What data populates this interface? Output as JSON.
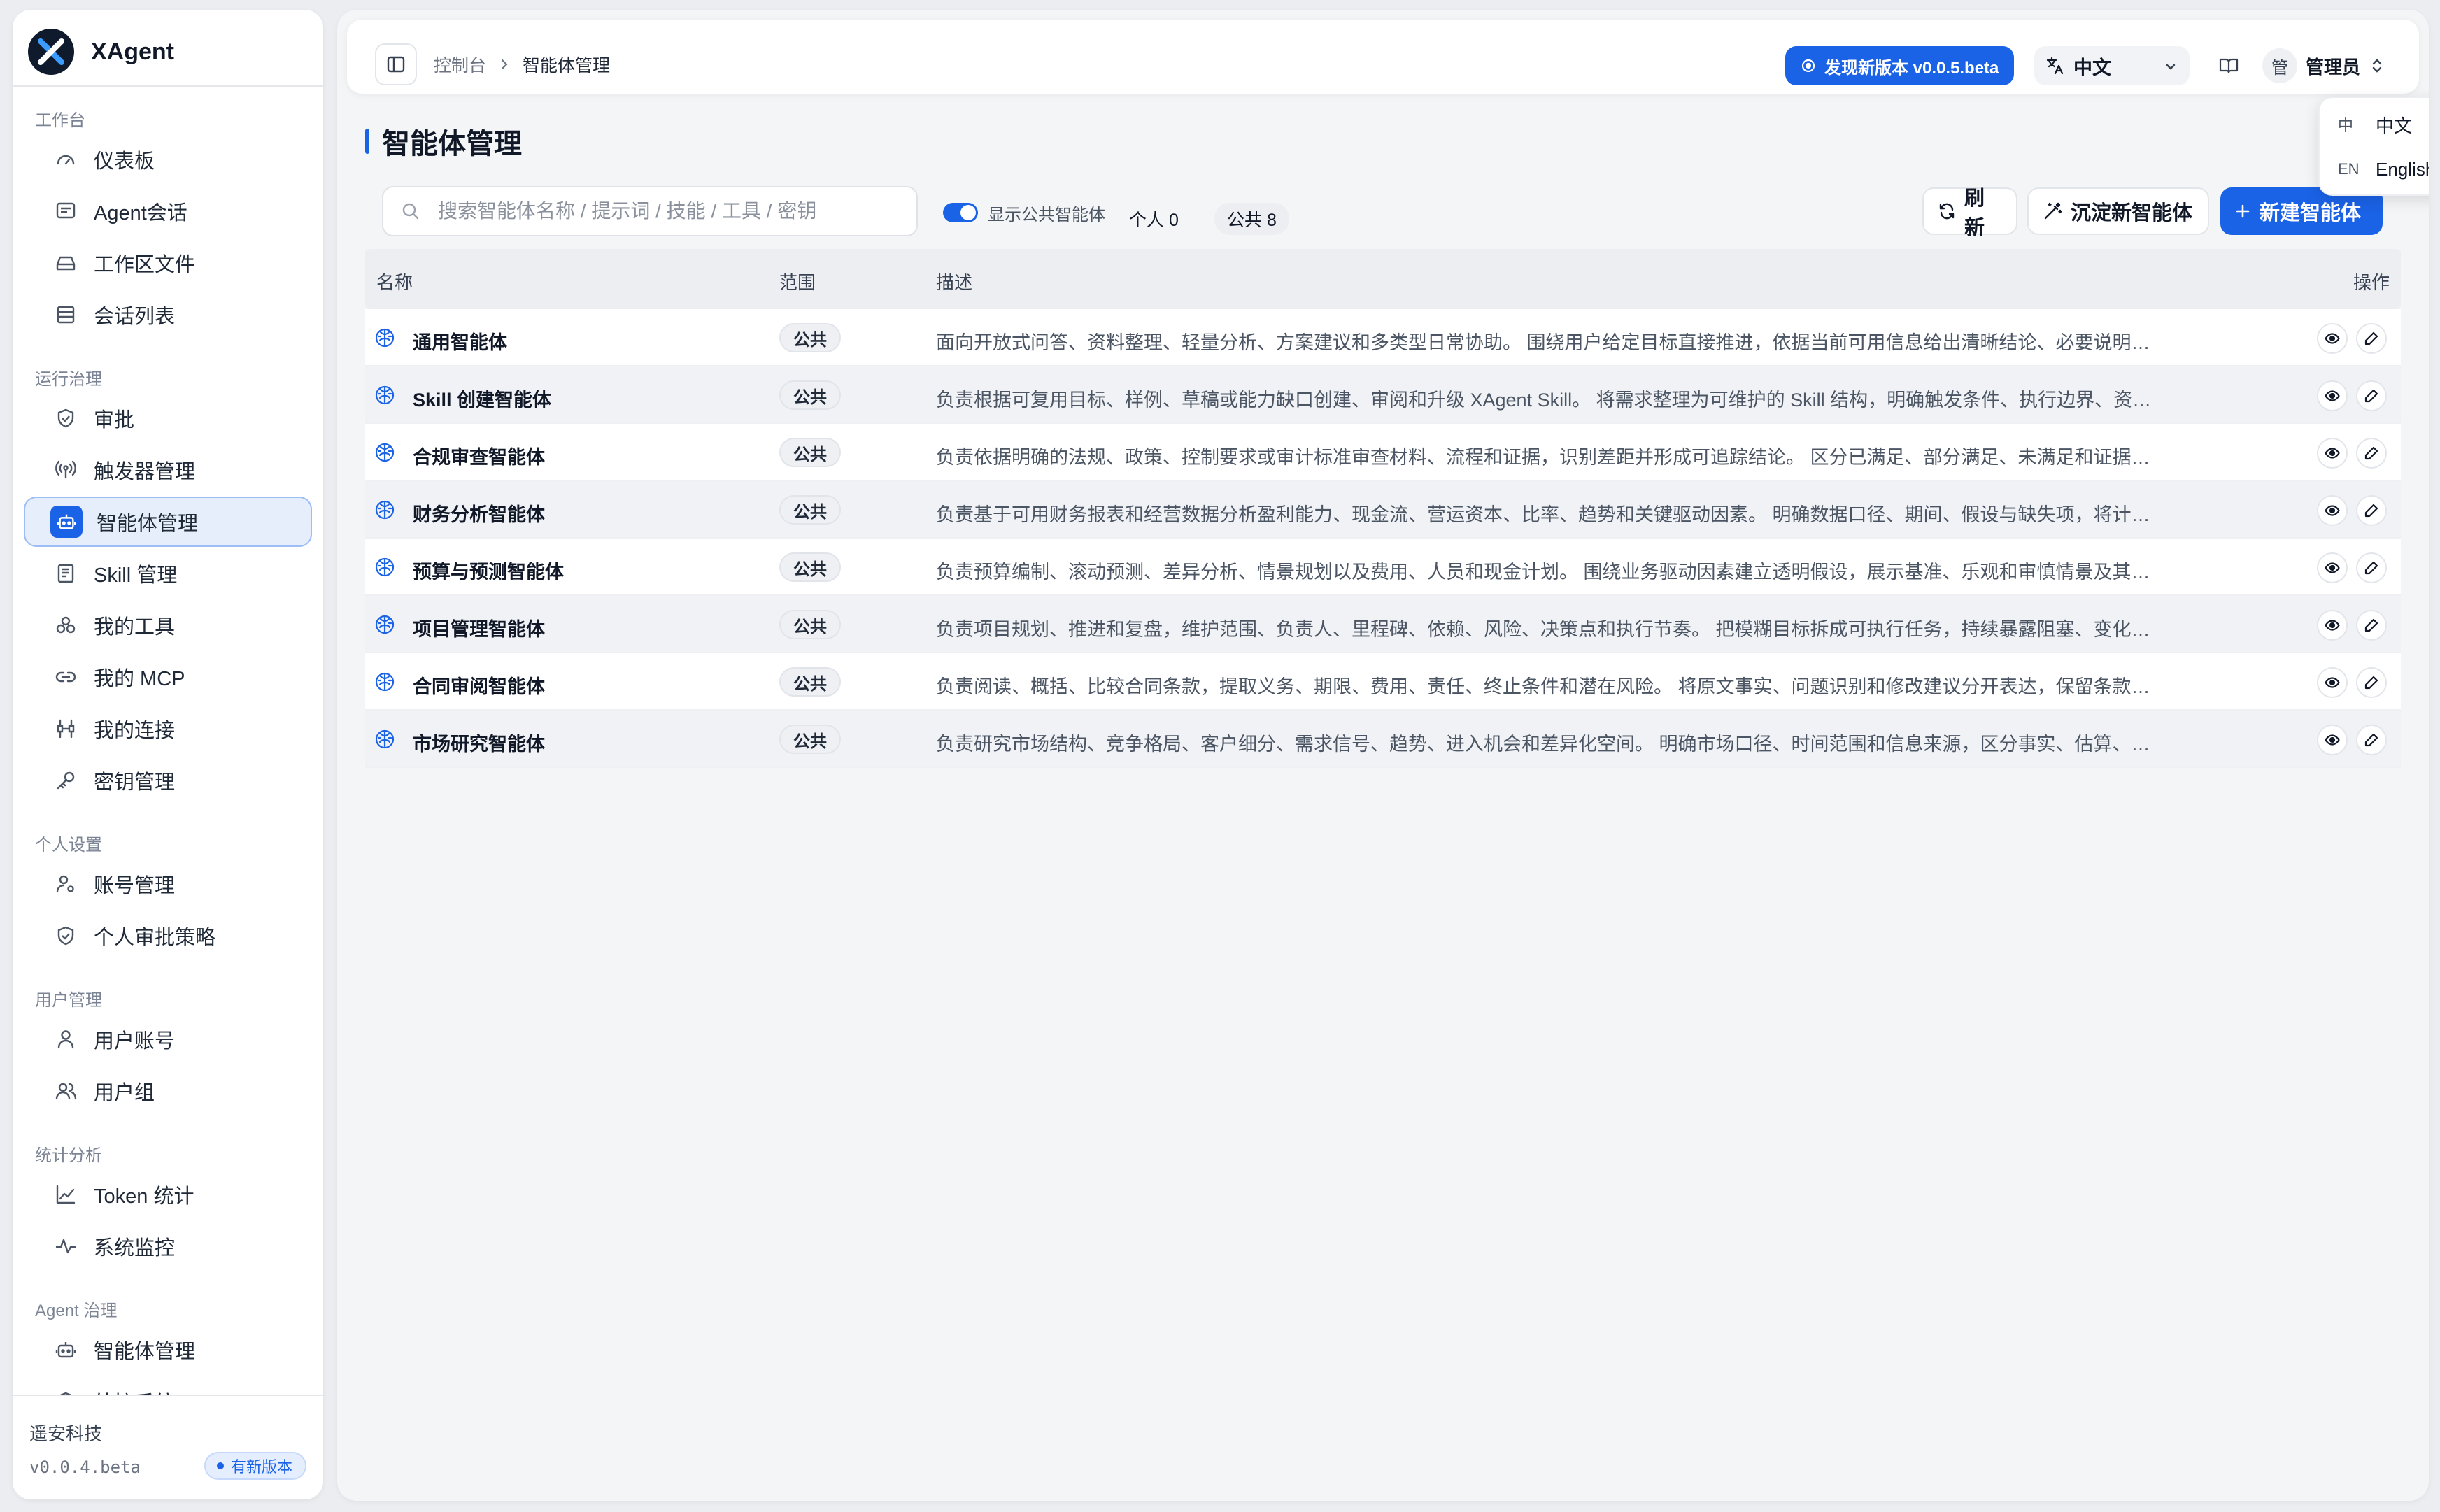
{
  "app": {
    "name": "XAgent"
  },
  "sidebar": {
    "sections": [
      {
        "title": "工作台",
        "items": [
          {
            "label": "仪表板",
            "icon": "gauge-icon"
          },
          {
            "label": "Agent会话",
            "icon": "chat-icon"
          },
          {
            "label": "工作区文件",
            "icon": "drive-icon"
          },
          {
            "label": "会话列表",
            "icon": "list-icon"
          }
        ]
      },
      {
        "title": "运行治理",
        "items": [
          {
            "label": "审批",
            "icon": "shield-check-icon"
          },
          {
            "label": "触发器管理",
            "icon": "broadcast-icon"
          },
          {
            "label": "智能体管理",
            "icon": "bot-icon",
            "active": true
          },
          {
            "label": "Skill 管理",
            "icon": "book-icon"
          },
          {
            "label": "我的工具",
            "icon": "tools-icon"
          },
          {
            "label": "我的 MCP",
            "icon": "link-icon"
          },
          {
            "label": "我的连接",
            "icon": "connection-icon"
          },
          {
            "label": "密钥管理",
            "icon": "key-icon"
          }
        ]
      },
      {
        "title": "个人设置",
        "items": [
          {
            "label": "账号管理",
            "icon": "user-gear-icon"
          },
          {
            "label": "个人审批策略",
            "icon": "shield-check-icon"
          }
        ]
      },
      {
        "title": "用户管理",
        "items": [
          {
            "label": "用户账号",
            "icon": "user-icon"
          },
          {
            "label": "用户组",
            "icon": "users-icon"
          }
        ]
      },
      {
        "title": "统计分析",
        "items": [
          {
            "label": "Token 统计",
            "icon": "line-chart-icon"
          },
          {
            "label": "系统监控",
            "icon": "activity-icon"
          }
        ]
      },
      {
        "title": "Agent 治理",
        "items": [
          {
            "label": "智能体管理",
            "icon": "bot-icon"
          },
          {
            "label": "外接系统",
            "icon": "plug-icon"
          }
        ]
      }
    ],
    "footer": {
      "company": "遥安科技",
      "version": "v0.0.4.beta",
      "update_badge": "有新版本"
    }
  },
  "topbar": {
    "breadcrumb": {
      "root": "控制台",
      "current": "智能体管理"
    },
    "new_version_button": "发现新版本 v0.0.5.beta",
    "language": {
      "selected": "中文"
    },
    "user": {
      "avatar_text": "管",
      "name": "管理员"
    }
  },
  "language_menu": {
    "options": [
      {
        "code": "中",
        "label": "中文",
        "selected": true
      },
      {
        "code": "EN",
        "label": "English",
        "selected": false
      }
    ]
  },
  "page": {
    "title": "智能体管理",
    "search": {
      "placeholder": "搜索智能体名称 / 提示词 / 技能 / 工具 / 密钥",
      "value": ""
    },
    "toggle": {
      "label": "显示公共智能体",
      "on": true
    },
    "counts": {
      "private": "个人 0",
      "public": "公共 8"
    },
    "buttons": {
      "refresh": "刷新",
      "distill": "沉淀新智能体",
      "create": "新建智能体"
    }
  },
  "table": {
    "columns": {
      "name": "名称",
      "scope": "范围",
      "desc": "描述",
      "ops": "操作"
    },
    "rows": [
      {
        "name": "通用智能体",
        "scope": "公共",
        "desc": "面向开放式问答、资料整理、轻量分析、方案建议和多类型日常协助。 围绕用户给定目标直接推进，依据当前可用信息给出清晰结论、必要说明和可..."
      },
      {
        "name": "Skill 创建智能体",
        "scope": "公共",
        "desc": "负责根据可复用目标、样例、草稿或能力缺口创建、审阅和升级 XAgent Skill。 将需求整理为可维护的 Skill 结构，明确触发条件、执行边界、资源依..."
      },
      {
        "name": "合规审查智能体",
        "scope": "公共",
        "desc": "负责依据明确的法规、政策、控制要求或审计标准审查材料、流程和证据，识别差距并形成可追踪结论。 区分已满足、部分满足、未满足和证据不足..."
      },
      {
        "name": "财务分析智能体",
        "scope": "公共",
        "desc": "负责基于可用财务报表和经营数据分析盈利能力、现金流、营运资本、比率、趋势和关键驱动因素。 明确数据口径、期间、假设与缺失项，将计算结..."
      },
      {
        "name": "预算与预测智能体",
        "scope": "公共",
        "desc": "负责预算编制、滚动预测、差异分析、情景规划以及费用、人员和现金计划。 围绕业务驱动因素建立透明假设，展示基准、乐观和审慎情景及其影响..."
      },
      {
        "name": "项目管理智能体",
        "scope": "公共",
        "desc": "负责项目规划、推进和复盘，维护范围、负责人、里程碑、依赖、风险、决策点和执行节奏。 把模糊目标拆成可执行任务，持续暴露阻塞、变化和需..."
      },
      {
        "name": "合同审阅智能体",
        "scope": "公共",
        "desc": "负责阅读、概括、比较合同条款，提取义务、期限、费用、责任、终止条件和潜在风险。 将原文事实、问题识别和修改建议分开表达，保留条款定位..."
      },
      {
        "name": "市场研究智能体",
        "scope": "公共",
        "desc": "负责研究市场结构、竞争格局、客户细分、需求信号、趋势、进入机会和差异化空间。 明确市场口径、时间范围和信息来源，区分事实、估算、假设..."
      }
    ]
  },
  "colors": {
    "accent": "#1a62e6",
    "background": "#ebedf1"
  }
}
